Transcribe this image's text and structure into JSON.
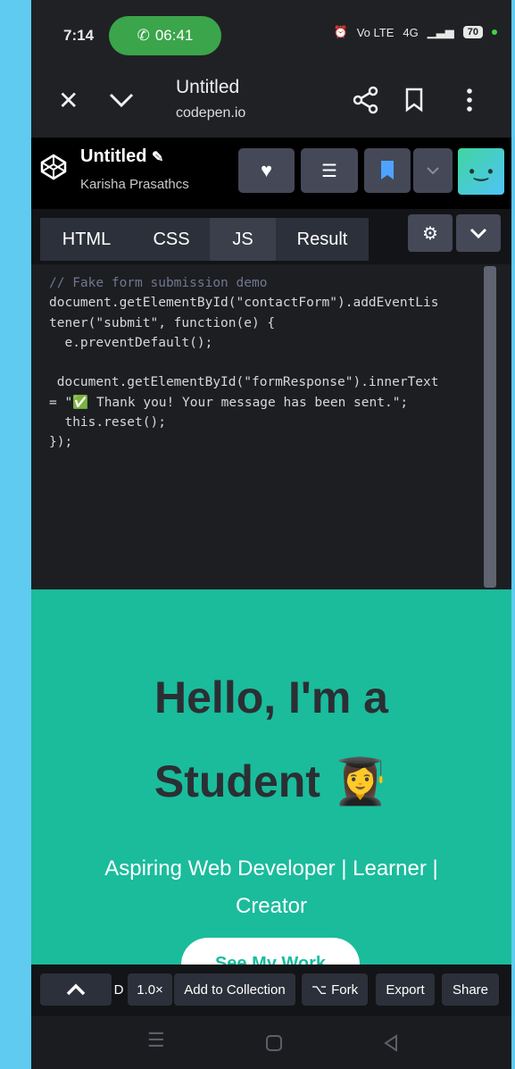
{
  "status_bar": {
    "time": "7:14",
    "call_timer": "06:41",
    "network_label": "Vo LTE",
    "signal_label": "4G",
    "battery": "70"
  },
  "browser": {
    "page_title": "Untitled",
    "domain": "codepen.io"
  },
  "codepen": {
    "pen_title": "Untitled",
    "author": "Karisha Prasathcs"
  },
  "editor": {
    "tabs": [
      "HTML",
      "CSS",
      "JS",
      "Result"
    ],
    "active_tab": "JS",
    "code_lines": [
      "// Fake form submission demo",
      "document.getElementById(\"contactForm\").addEventLis",
      "tener(\"submit\", function(e) {",
      "  e.preventDefault();",
      "",
      " document.getElementById(\"formResponse\").innerText",
      "= \"✅ Thank you! Your message has been sent.\";",
      "  this.reset();",
      "});"
    ]
  },
  "result": {
    "heading_line1": "Hello, I'm a",
    "heading_line2": "Student 👩‍🎓",
    "subtitle": "Aspiring Web Developer | Learner | Creator",
    "cta": "See My Work",
    "background": "#1abc9c"
  },
  "footer": {
    "d_label": "D",
    "zoom": "1.0×",
    "add_collection": "Add to Collection",
    "fork": "Fork",
    "export": "Export",
    "share": "Share"
  }
}
